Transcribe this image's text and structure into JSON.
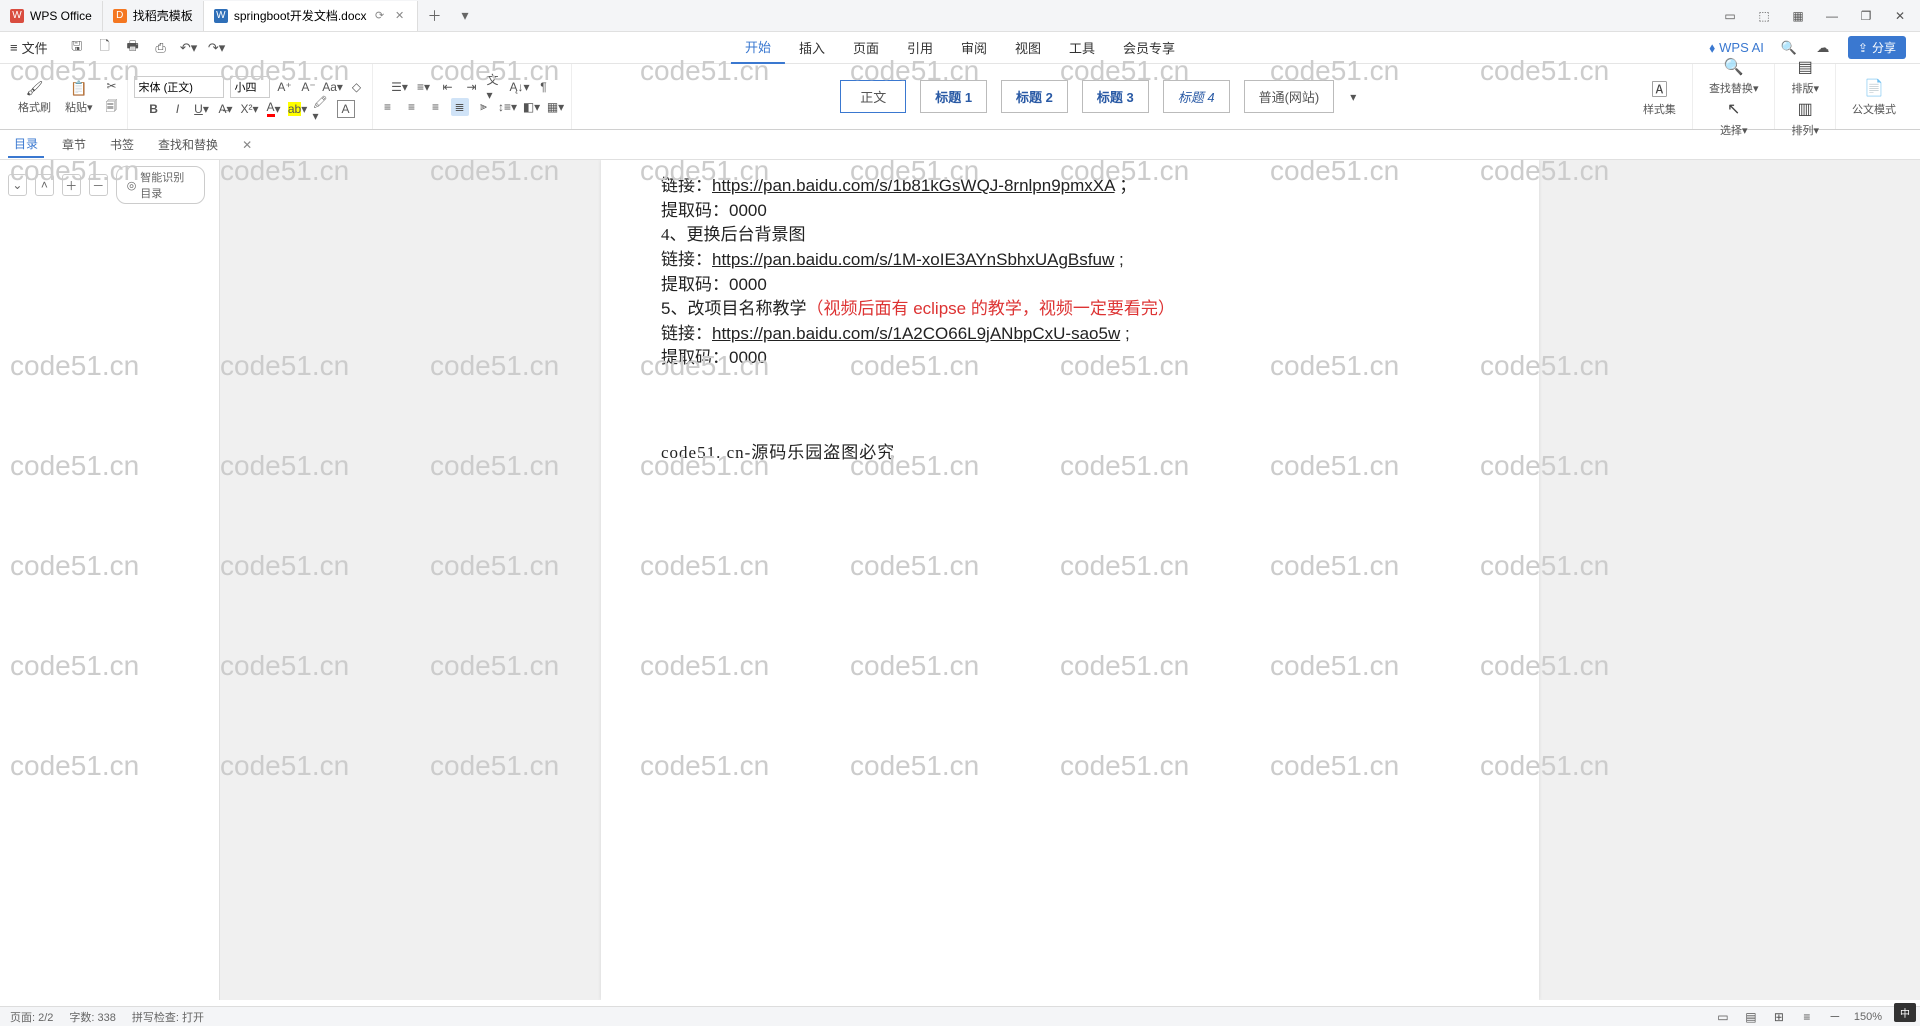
{
  "tabs": [
    {
      "icon": "W",
      "label": "WPS Office",
      "cls": "red"
    },
    {
      "icon": "D",
      "label": "找稻壳模板",
      "cls": "orange"
    },
    {
      "icon": "W",
      "label": "springboot开发文档.docx",
      "cls": "blue"
    }
  ],
  "menu": {
    "file": "文件",
    "items": [
      "开始",
      "插入",
      "页面",
      "引用",
      "审阅",
      "视图",
      "工具",
      "会员专享"
    ],
    "active": 0,
    "wps_ai": "WPS AI",
    "share": "分享"
  },
  "ribbon": {
    "format_brush": "格式刷",
    "paste": "粘贴",
    "font_name": "宋体 (正文)",
    "font_size": "小四",
    "styles": [
      "正文",
      "标题 1",
      "标题 2",
      "标题 3",
      "标题 4",
      "普通(网站)"
    ],
    "styles_btn": "样式集",
    "find_replace": "查找替换",
    "select": "选择",
    "layout": "排版",
    "align": "排列",
    "official": "公文模式"
  },
  "nav": {
    "tabs": [
      "目录",
      "章节",
      "书签",
      "查找和替换"
    ],
    "active": 0,
    "smart": "智能识别目录"
  },
  "doc": {
    "l1": {
      "a": "链接：",
      "b": "https://pan.baidu.com/s/1b81kGsWQJ-8rnlpn9pmxXA",
      "c": " ；"
    },
    "l2": {
      "a": "提取码：",
      "b": "0000"
    },
    "l3": "4、更换后台背景图",
    "l4": {
      "a": "链接：",
      "b": "https://pan.baidu.com/s/1M-xoIE3AYnSbhxUAgBsfuw",
      "c": " ;"
    },
    "l5": {
      "a": "提取码：",
      "b": "0000"
    },
    "l6": {
      "a": "5、改项目名称教学",
      "b": "（视频后面有 eclipse 的教学，视频一定要看完）"
    },
    "l7": {
      "a": "链接：",
      "b": "https://pan.baidu.com/s/1A2CO66L9jANbpCxU-sao5w",
      "c": " ;"
    },
    "l8": {
      "a": "提取码：",
      "b": "0000"
    },
    "big": "code51. cn-源码乐园盗图必究"
  },
  "status": {
    "page": "页面: 2/2",
    "words": "字数: 338",
    "spell": "拼写检查: 打开",
    "ime": "中"
  },
  "watermark": "code51.cn",
  "zoom": "150%"
}
